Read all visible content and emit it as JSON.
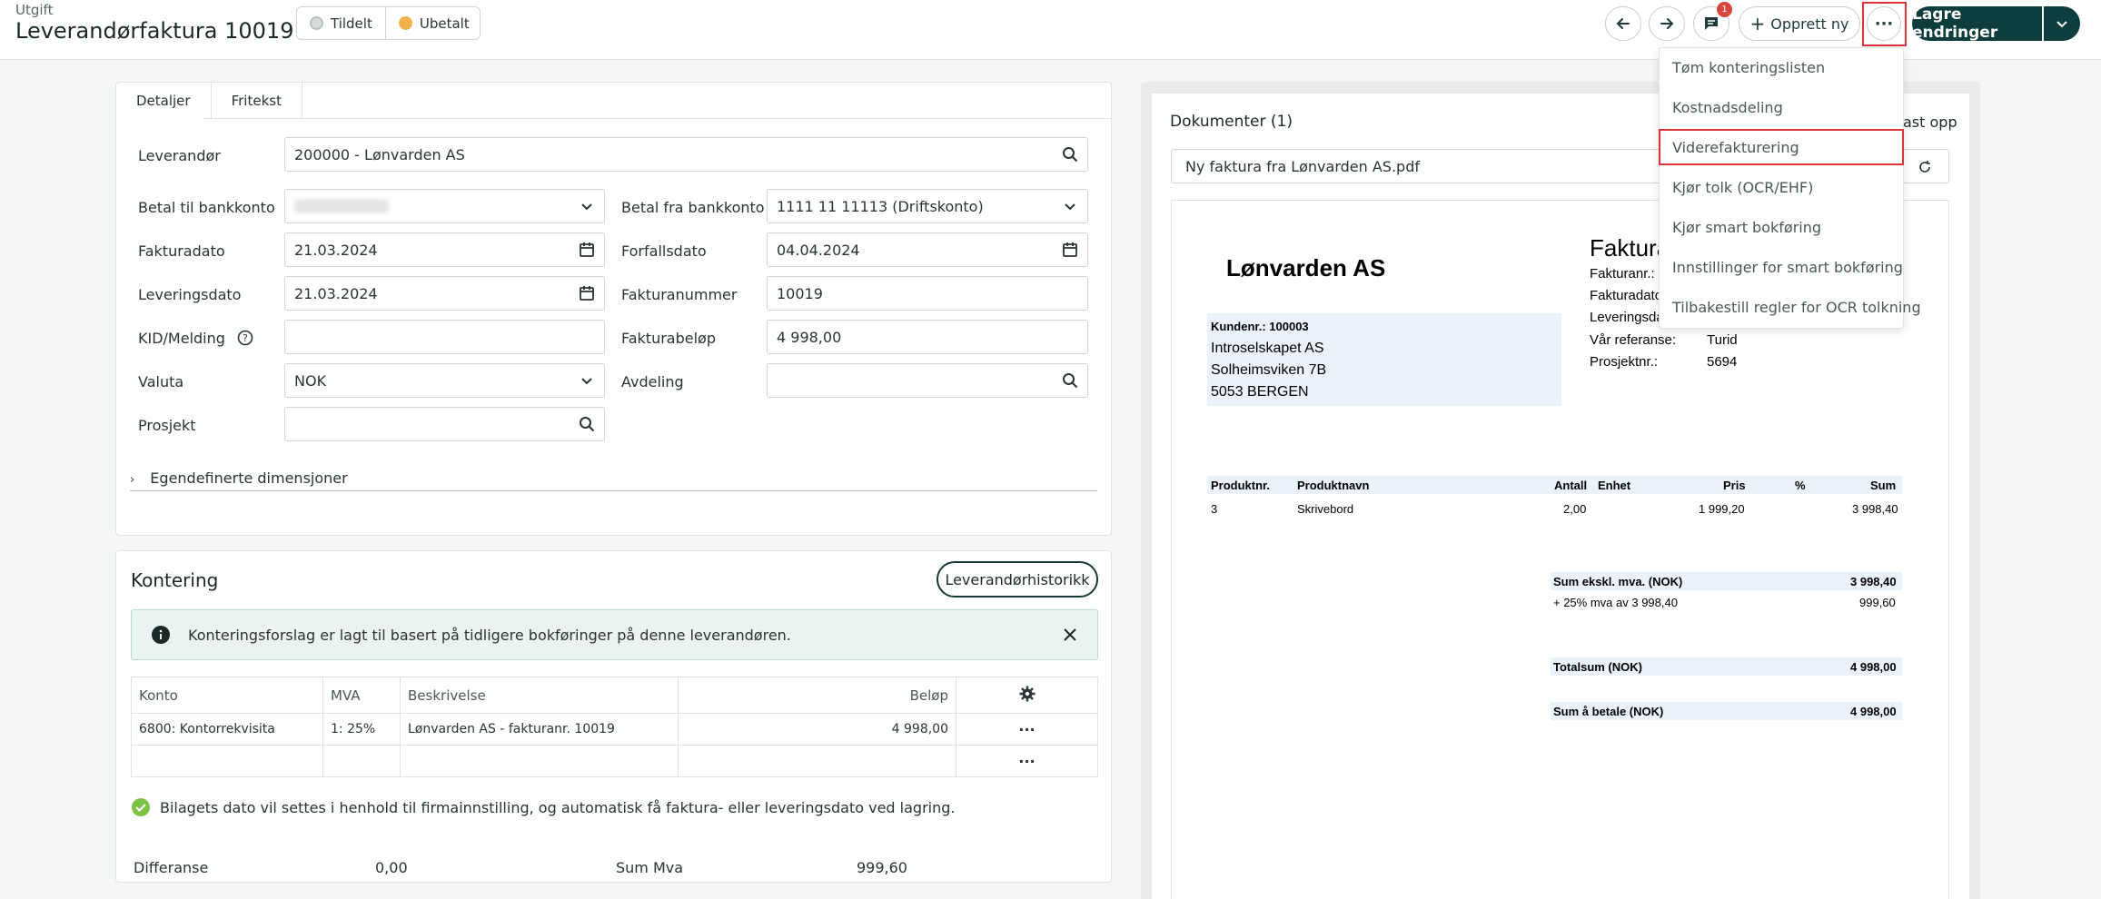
{
  "header": {
    "subtitle": "Utgift",
    "title": "Leverandørfaktura 10019",
    "status_assigned": "Tildelt",
    "status_payment": "Ubetalt",
    "comment_count": "1",
    "create_label": "Opprett ny",
    "save_label": "Lagre endringer"
  },
  "tabs": [
    "Detaljer",
    "Fritekst"
  ],
  "form": {
    "supplier_label": "Leverandør",
    "supplier_value": "200000 - Lønvarden AS",
    "pay_to_label": "Betal til bankkonto",
    "pay_from_label": "Betal fra bankkonto",
    "pay_from_value": "1111 11 11113 (Driftskonto)",
    "invoice_date_label": "Fakturadato",
    "invoice_date_value": "21.03.2024",
    "due_date_label": "Forfallsdato",
    "due_date_value": "04.04.2024",
    "delivery_date_label": "Leveringsdato",
    "delivery_date_value": "21.03.2024",
    "invoice_number_label": "Fakturanummer",
    "invoice_number_value": "10019",
    "kid_label": "KID/Melding",
    "amount_label": "Fakturabeløp",
    "amount_value": "4 998,00",
    "currency_label": "Valuta",
    "currency_value": "NOK",
    "department_label": "Avdeling",
    "project_label": "Prosjekt",
    "custom_dimensions": "Egendefinerte dimensjoner"
  },
  "kontering": {
    "title": "Kontering",
    "history_button": "Leverandørhistorikk",
    "info_text": "Konteringsforslag er lagt til basert på tidligere bokføringer på denne leverandøren.",
    "columns": [
      "Konto",
      "MVA",
      "Beskrivelse",
      "Beløp"
    ],
    "rows": [
      {
        "konto": "6800: Kontorrekvisita",
        "mva": "1: 25%",
        "beskrivelse": "Lønvarden AS - fakturanr. 10019",
        "belop": "4 998,00"
      }
    ],
    "success_text": "Bilagets dato vil settes i henhold til firmainnstilling, og automatisk få faktura- eller leveringsdato ved lagring.",
    "diff_label": "Differanse",
    "diff_value": "0,00",
    "sum_mva_label": "Sum Mva",
    "sum_mva_value": "999,60"
  },
  "documents": {
    "title": "Dokumenter (1)",
    "upload_label": "ast opp",
    "file_name": "Ny faktura fra Lønvarden AS.pdf"
  },
  "invoice": {
    "company": "Lønvarden AS",
    "heading": "Faktura",
    "meta_labels": [
      "Fakturanr.:",
      "Fakturadato",
      "Leveringsda",
      "Vår referanse:",
      "Prosjektnr.:"
    ],
    "reference": "Turid",
    "project_no": "5694",
    "customer_no": "Kundenr.: 100003",
    "customer_lines": [
      "Introselskapet AS",
      "Solheimsviken 7B",
      "5053  BERGEN"
    ],
    "table_headers": [
      "Produktnr.",
      "Produktnavn",
      "Antall",
      "Enhet",
      "Pris",
      "%",
      "Sum"
    ],
    "line": {
      "nr": "3",
      "name": "Skrivebord",
      "qty": "2,00",
      "price": "1 999,20",
      "sum": "3 998,40"
    },
    "sum_excl_label": "Sum ekskl. mva. (NOK)",
    "sum_excl_value": "3 998,40",
    "vat_label": "+ 25% mva av 3 998,40",
    "vat_value": "999,60",
    "total_label": "Totalsum (NOK)",
    "total_value": "4 998,00",
    "to_pay_label": "Sum å betale (NOK)",
    "to_pay_value": "4 998,00"
  },
  "menu": {
    "items": [
      "Tøm konteringslisten",
      "Kostnadsdeling",
      "Viderefakturering",
      "Kjør tolk (OCR/EHF)",
      "Kjør smart bokføring",
      "Innstillinger for smart bokføring",
      "Tilbakestill regler for OCR tolkning"
    ]
  }
}
